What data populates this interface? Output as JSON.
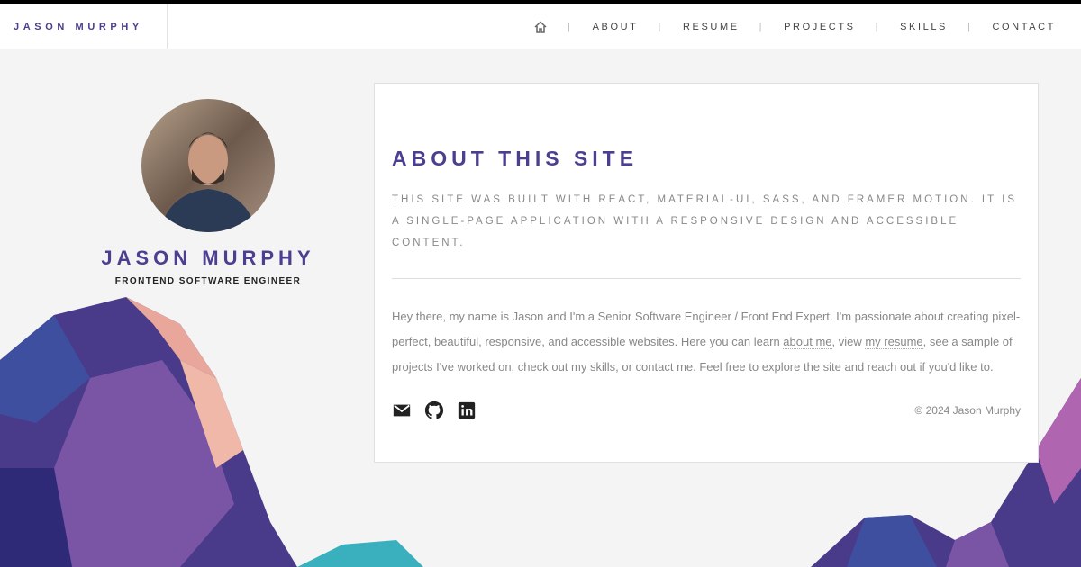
{
  "header": {
    "brand": "JASON MURPHY",
    "nav": [
      "ABOUT",
      "RESUME",
      "PROJECTS",
      "SKILLS",
      "CONTACT"
    ]
  },
  "profile": {
    "name": "JASON MURPHY",
    "title": "FRONTEND SOFTWARE ENGINEER"
  },
  "card": {
    "heading": "ABOUT THIS SITE",
    "subtitle": "THIS SITE WAS BUILT WITH REACT, MATERIAL-UI, SASS, AND FRAMER MOTION. IT IS A SINGLE-PAGE APPLICATION WITH A RESPONSIVE DESIGN AND ACCESSIBLE CONTENT.",
    "body": {
      "t1": "Hey there, my name is Jason and I'm a Senior Software Engineer / Front End Expert. I'm passionate about creating pixel-perfect, beautiful, responsive, and accessible websites. Here you can learn ",
      "l1": "about me",
      "t2": ", view ",
      "l2": "my resume",
      "t3": ", see a sample of ",
      "l3": "projects I've worked on",
      "t4": ", check out ",
      "l4": "my skills",
      "t5": ", or ",
      "l5": "contact me",
      "t6": ". Feel free to explore the site and reach out if you'd like to."
    },
    "copyright": "© 2024 Jason Murphy"
  }
}
